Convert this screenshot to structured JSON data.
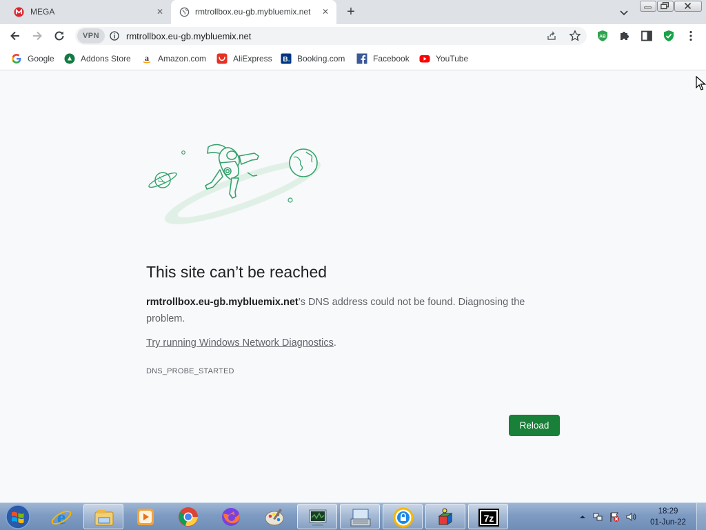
{
  "tabs": [
    {
      "title": "MEGA",
      "favicon": "mega-icon",
      "active": false
    },
    {
      "title": "rmtrollbox.eu-gb.mybluemix.net",
      "favicon": "globe-icon",
      "active": true
    }
  ],
  "toolbar": {
    "vpn_label": "VPN",
    "url": "rmtrollbox.eu-gb.mybluemix.net"
  },
  "bookmarks": [
    {
      "label": "Google",
      "icon": "google-icon"
    },
    {
      "label": "Addons Store",
      "icon": "addons-store-icon"
    },
    {
      "label": "Amazon.com",
      "icon": "amazon-icon"
    },
    {
      "label": "AliExpress",
      "icon": "aliexpress-icon"
    },
    {
      "label": "Booking.com",
      "icon": "booking-icon"
    },
    {
      "label": "Facebook",
      "icon": "facebook-icon"
    },
    {
      "label": "YouTube",
      "icon": "youtube-icon"
    }
  ],
  "error": {
    "title": "This site can’t be reached",
    "host": "rmtrollbox.eu-gb.mybluemix.net",
    "desc_rest": "’s DNS address could not be found. Diagnosing the problem.",
    "diag_link": "Try running Windows Network Diagnostics",
    "diag_period": ".",
    "code": "DNS_PROBE_STARTED",
    "reload_label": "Reload"
  },
  "taskbar": {
    "apps": [
      "internet-explorer-icon",
      "file-explorer-icon",
      "media-player-icon",
      "chrome-icon",
      "firefox-icon",
      "paint-icon",
      "task-manager-icon",
      "on-screen-keyboard-icon",
      "vpn-app-icon",
      "3d-app-icon",
      "7zip-icon"
    ],
    "time": "18:29",
    "date": "01-Jun-22"
  },
  "colors": {
    "accent": "#188038",
    "illustration": "#34a36b",
    "taskbar": "#7e9bc2"
  }
}
